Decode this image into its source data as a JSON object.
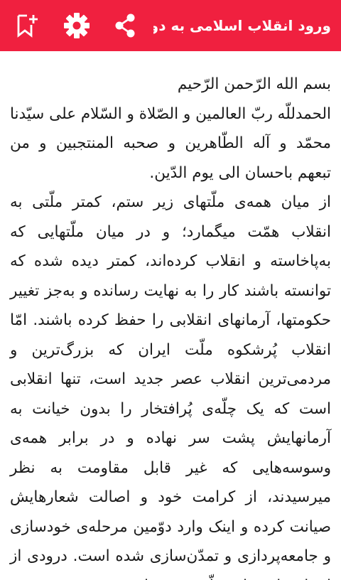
{
  "appbar": {
    "title": "ورود انقلاب اسلامی به دومین...",
    "background": "#f0203f",
    "icons": [
      "share-icon",
      "gear-icon",
      "bookmark-add-icon"
    ]
  },
  "article": {
    "opening": "بسم الله الرّحمن الرّحیم",
    "salutation": "الحمدللّه ربّ العالمین و الصّلاة و السّلام علی سیّدنا محمّد و آله الطّاهرین و صحبه المنتجبین و من تبعهم باحسان الی یوم الدّین.",
    "body": "از میان همه‌ی ملّتهای زیر ستم، کمتر ملّتی به انقلاب همّت میگمارد؛ و در میان ملّتهایی که به‌پاخاسته و انقلاب کرده‌اند، کمتر دیده شده که توانسته باشند کار را به نهایت رسانده و به‌جز تغییر حکومتها، آرمانهای انقلابی را حفظ کرده باشند. امّا انقلاب پُرشکوه ملّت ایران که بزرگ‌ترین و مردمی‌ترین انقلاب عصر جدید است، تنها انقلابی است که یک چلّه‌ی پُرافتخار را بدون خیانت به آرمانهایش پشت سر نهاده و در برابر همه‌ی وسوسه‌هایی که غیر قابل مقاومت به نظر میرسیدند، از کرامت خود و اصالت شعارهایش صیانت کرده و اینک وارد دوّمین مرحله‌ی خودسازی و جامعه‌پردازی و تمدّن‌سازی شده است. درودی از اعماق دل بر این ملّت؛ بر نسل"
  }
}
